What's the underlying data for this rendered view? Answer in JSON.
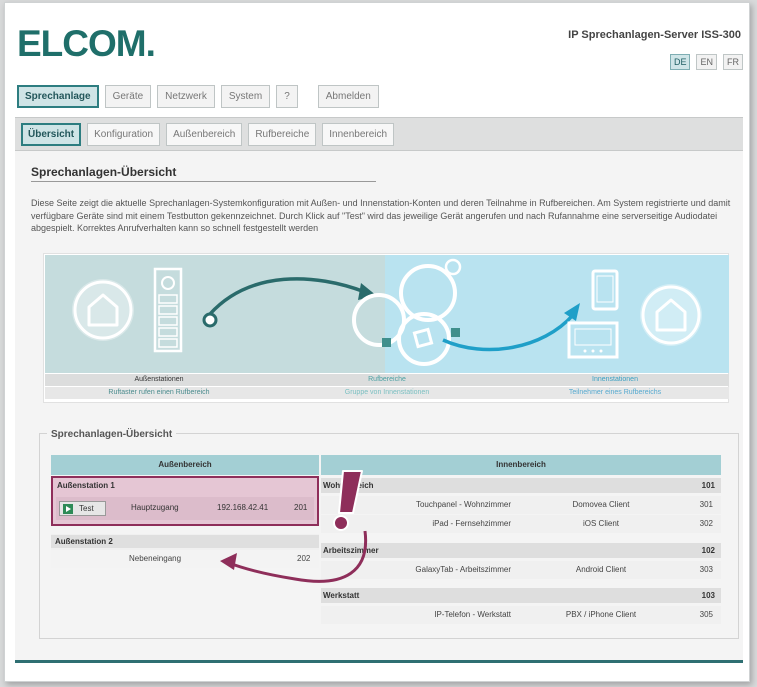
{
  "header": {
    "logo": "ELCOM.",
    "product": "IP Sprechanlagen-Server ISS-300",
    "languages": [
      "DE",
      "EN",
      "FR"
    ],
    "active_language": "DE"
  },
  "main_nav": {
    "items": [
      "Sprechanlage",
      "Geräte",
      "Netzwerk",
      "System",
      "?",
      "Abmelden"
    ],
    "active": "Sprechanlage"
  },
  "sub_nav": {
    "items": [
      "Übersicht",
      "Konfiguration",
      "Außenbereich",
      "Rufbereiche",
      "Innenbereich"
    ],
    "active": "Übersicht"
  },
  "page": {
    "title": "Sprechanlagen-Übersicht",
    "description": "Diese Seite zeigt die aktuelle Sprechanlagen-Systemkonfiguration mit Außen- und Innenstation-Konten und deren Teilnahme in Rufbereichen. Am System registrierte und damit verfügbare Geräte sind mit einem Testbutton gekennzeichnet. Durch Klick auf \"Test\" wird das jeweilige Gerät angerufen und nach Rufannahme eine serverseitige Audiodatei abgespielt. Korrektes Anrufverhalten kann so schnell festgestellt werden"
  },
  "diagram": {
    "columns": [
      {
        "title": "Außenstationen",
        "subtitle": "Ruftaster rufen einen Rufbereich"
      },
      {
        "title": "Rufbereiche",
        "subtitle": "Gruppe von Innenstationen"
      },
      {
        "title": "Innenstationen",
        "subtitle": "Teilnehmer eines Rufbereichs"
      }
    ],
    "colors": {
      "left_bg": "#c5dcdd",
      "right_bg": "#b9e3f0",
      "teal": "#2a8686",
      "cyan": "#2ab0d8"
    }
  },
  "overview": {
    "title": "Sprechanlagen-Übersicht",
    "left_header": "Außenbereich",
    "right_header": "Innenbereich",
    "outdoor_stations": [
      {
        "name": "Außenstation 1",
        "highlighted": true,
        "rows": [
          {
            "test_label": "Test",
            "location": "Hauptzugang",
            "ip": "192.168.42.41",
            "number": "201"
          }
        ]
      },
      {
        "name": "Außenstation 2",
        "highlighted": false,
        "rows": [
          {
            "location": "Nebeneingang",
            "number": "202"
          }
        ]
      }
    ],
    "call_areas": [
      {
        "name": "Wohnbereich",
        "number": "101",
        "devices": [
          {
            "name": "Touchpanel - Wohnzimmer",
            "client": "Domovea Client",
            "number": "301"
          },
          {
            "name": "iPad - Fernsehzimmer",
            "client": "iOS Client",
            "number": "302"
          }
        ]
      },
      {
        "name": "Arbeitszimmer",
        "number": "102",
        "devices": [
          {
            "name": "GalaxyTab - Arbeitszimmer",
            "client": "Android Client",
            "number": "303"
          }
        ]
      },
      {
        "name": "Werkstatt",
        "number": "103",
        "devices": [
          {
            "name": "IP-Telefon - Werkstatt",
            "client": "PBX / iPhone Client",
            "number": "305"
          }
        ]
      }
    ],
    "colors": {
      "highlight_border": "#8e2e5a",
      "highlight_bg": "#e5c6d4",
      "header_bg": "#a3cfd4"
    }
  }
}
